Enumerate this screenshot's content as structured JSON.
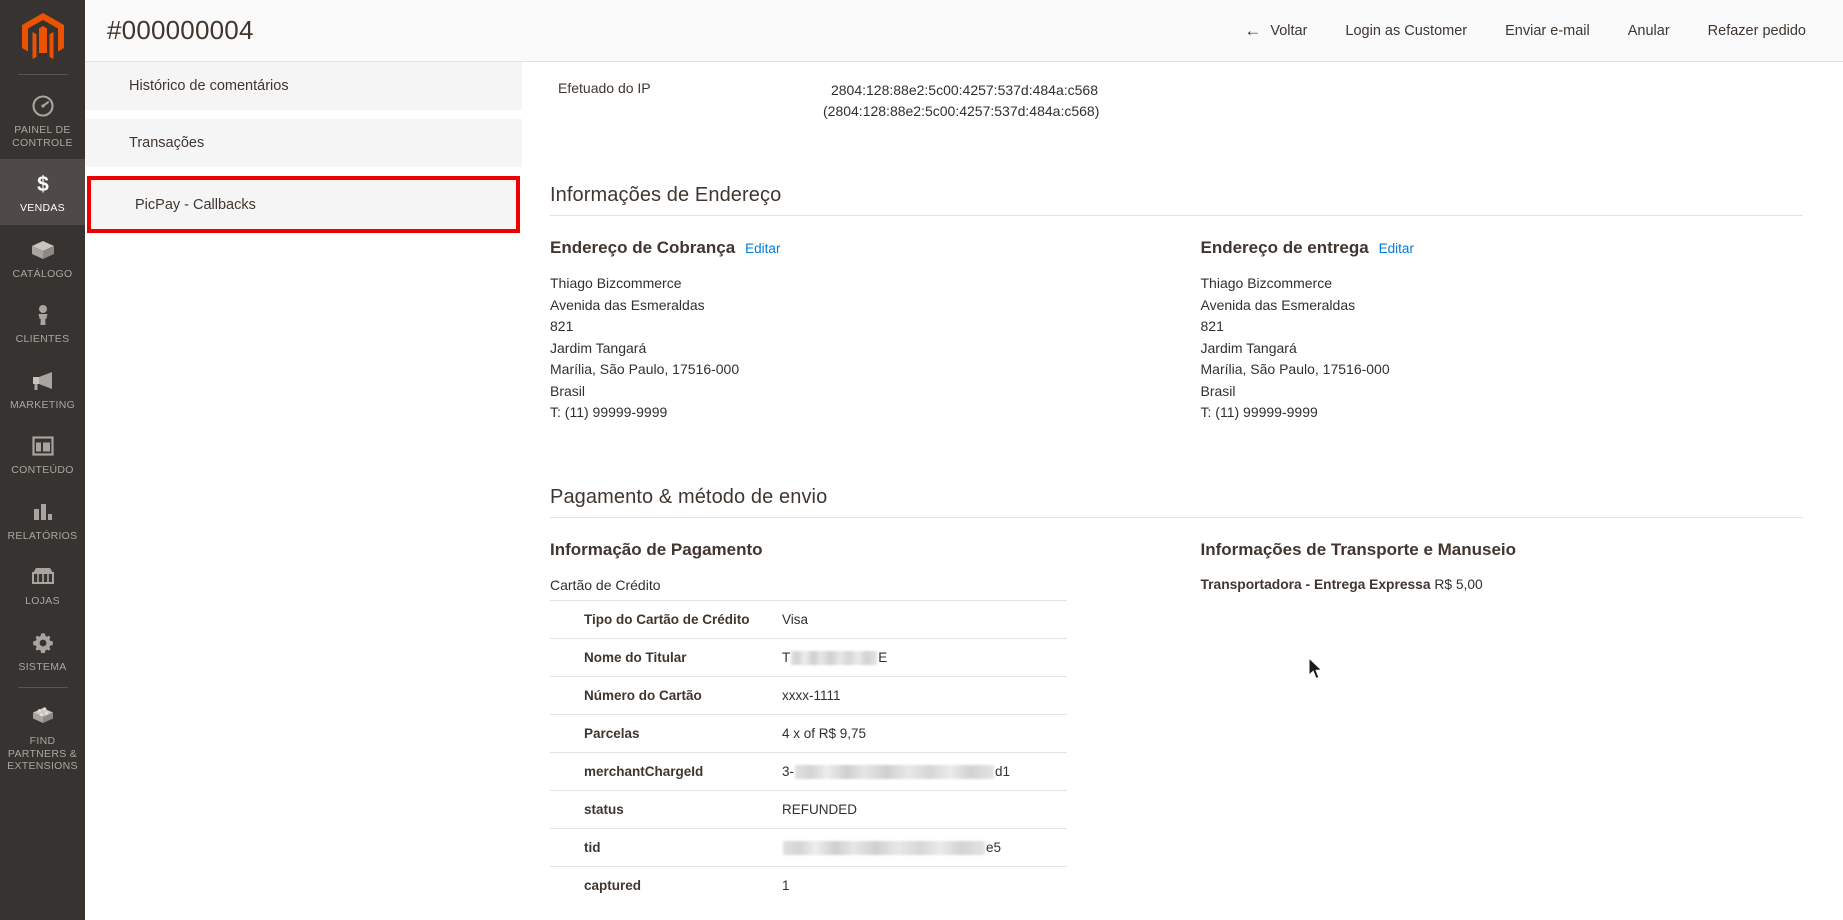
{
  "sidebar": {
    "logo_name": "magento-logo",
    "items": [
      {
        "label": "Painel de Controle",
        "icon": "dashboard-icon",
        "active": false
      },
      {
        "label": "Vendas",
        "icon": "dollar-icon",
        "active": true
      },
      {
        "label": "Catálogo",
        "icon": "box-icon",
        "active": false
      },
      {
        "label": "Clientes",
        "icon": "person-icon",
        "active": false
      },
      {
        "label": "Marketing",
        "icon": "megaphone-icon",
        "active": false
      },
      {
        "label": "Conteúdo",
        "icon": "layout-icon",
        "active": false
      },
      {
        "label": "Relatórios",
        "icon": "bar-chart-icon",
        "active": false
      },
      {
        "label": "Lojas",
        "icon": "store-icon",
        "active": false
      },
      {
        "label": "Sistema",
        "icon": "gear-icon",
        "active": false
      },
      {
        "label": "Find Partners & Extensions",
        "icon": "puzzle-brick-icon",
        "active": false
      }
    ]
  },
  "header": {
    "title": "#000000004",
    "buttons": [
      {
        "label": "Voltar",
        "icon": "arrow-left-icon"
      },
      {
        "label": "Login as Customer",
        "icon": ""
      },
      {
        "label": "Enviar e-mail",
        "icon": ""
      },
      {
        "label": "Anular",
        "icon": ""
      },
      {
        "label": "Refazer pedido",
        "icon": ""
      }
    ]
  },
  "order_nav": {
    "items": [
      {
        "label": "Histórico de comentários",
        "highlighted": false
      },
      {
        "label": "Transações",
        "highlighted": false
      },
      {
        "label": "PicPay - Callbacks",
        "highlighted": true
      }
    ],
    "highlight_color": "#ee0000"
  },
  "ip_block": {
    "label": "Efetuado do IP",
    "value_line1": "2804:128:88e2:5c00:4257:537d:484a:c568",
    "value_line2": "(2804:128:88e2:5c00:4257:537d:484a:c568)"
  },
  "address_section": {
    "title": "Informações de Endereço",
    "billing": {
      "heading": "Endereço de Cobrança",
      "edit_label": "Editar",
      "lines": [
        "Thiago Bizcommerce",
        "Avenida das Esmeraldas",
        "821",
        "Jardim Tangará",
        "Marília, São Paulo, 17516-000",
        "Brasil",
        "T: (11) 99999-9999"
      ]
    },
    "shipping": {
      "heading": "Endereço de entrega",
      "edit_label": "Editar",
      "lines": [
        "Thiago Bizcommerce",
        "Avenida das Esmeraldas",
        "821",
        "Jardim Tangará",
        "Marília, São Paulo, 17516-000",
        "Brasil",
        "T: (11) 99999-9999"
      ]
    }
  },
  "payment_section": {
    "title": "Pagamento & método de envio",
    "payment": {
      "heading": "Informação de Pagamento",
      "method": "Cartão de Crédito",
      "rows": [
        {
          "label": "Tipo do Cartão de Crédito",
          "value": "Visa",
          "redacted": false
        },
        {
          "label": "Nome do Titular",
          "value_prefix": "T",
          "value_suffix": "E",
          "redacted": true,
          "redact_width": "w-name"
        },
        {
          "label": "Número do Cartão",
          "value": "xxxx-1111",
          "redacted": false
        },
        {
          "label": "Parcelas",
          "value": "4 x of R$ 9,75",
          "redacted": false
        },
        {
          "label": "merchantChargeId",
          "value_prefix": "3-",
          "value_suffix": "d1",
          "redacted": true,
          "redact_width": "w-charge"
        },
        {
          "label": "status",
          "value": "REFUNDED",
          "redacted": false
        },
        {
          "label": "tid",
          "value_prefix": "",
          "value_suffix": "e5",
          "redacted": true,
          "redact_width": "w-tid"
        },
        {
          "label": "captured",
          "value": "1",
          "redacted": false
        }
      ]
    },
    "shipping_info": {
      "heading": "Informações de Transporte e Manuseio",
      "method_label": "Transportadora - Entrega Expressa",
      "price": "R$ 5,00"
    }
  },
  "colors": {
    "sidebar_bg": "#373330",
    "accent_orange": "#eb5202",
    "link_blue": "#007bdb",
    "highlight_red": "#ee0000",
    "text_dark": "#41362f"
  }
}
